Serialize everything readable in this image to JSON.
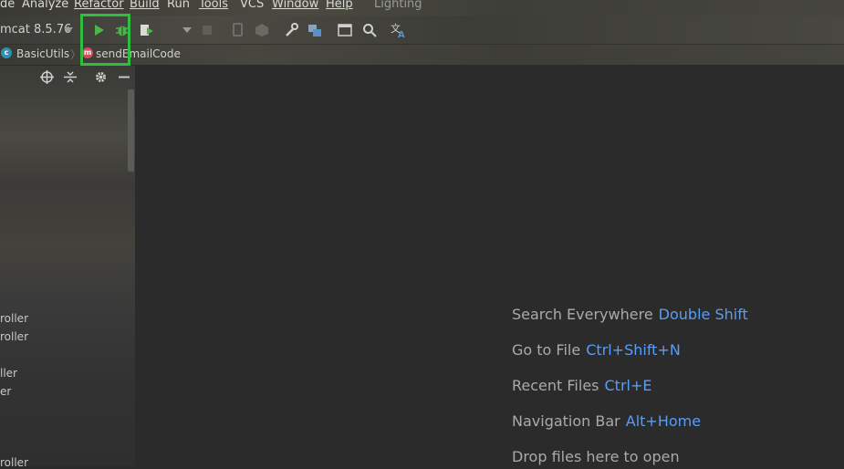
{
  "menu": [
    {
      "label": "de"
    },
    {
      "label": "Analyze"
    },
    {
      "label": "Refactor"
    },
    {
      "label": "Build"
    },
    {
      "label": "Run"
    },
    {
      "label": "Tools"
    },
    {
      "label": "VCS"
    },
    {
      "label": "Window"
    },
    {
      "label": "Help"
    }
  ],
  "project_name": "Lighting",
  "toolbar": {
    "run_configuration": "mcat 8.5.76",
    "icons": [
      "run-icon",
      "debug-icon",
      "run-with-coverage-icon",
      "dropdown-icon",
      "stop-icon",
      "device-icon",
      "profiler-icon",
      "wrench-icon",
      "project-structure-icon",
      "terminal-window-icon",
      "search-icon",
      "translate-icon"
    ]
  },
  "breadcrumb": {
    "class_badge": "c",
    "class_name": "BasicUtils",
    "method_badge": "m",
    "method_name": "sendEmailCode"
  },
  "left_panel": {
    "items": [
      "roller",
      "roller",
      "ller",
      "er",
      "roller"
    ]
  },
  "editor": {
    "hints": [
      {
        "label": "Search Everywhere",
        "key": "Double Shift"
      },
      {
        "label": "Go to File",
        "key": "Ctrl+Shift+N"
      },
      {
        "label": "Recent Files",
        "key": "Ctrl+E"
      },
      {
        "label": "Navigation Bar",
        "key": "Alt+Home"
      },
      {
        "label": "Drop files here to open",
        "key": ""
      }
    ]
  },
  "colors": {
    "highlight": "#2fbf3f",
    "link": "#589df6",
    "run": "#4db34a"
  }
}
